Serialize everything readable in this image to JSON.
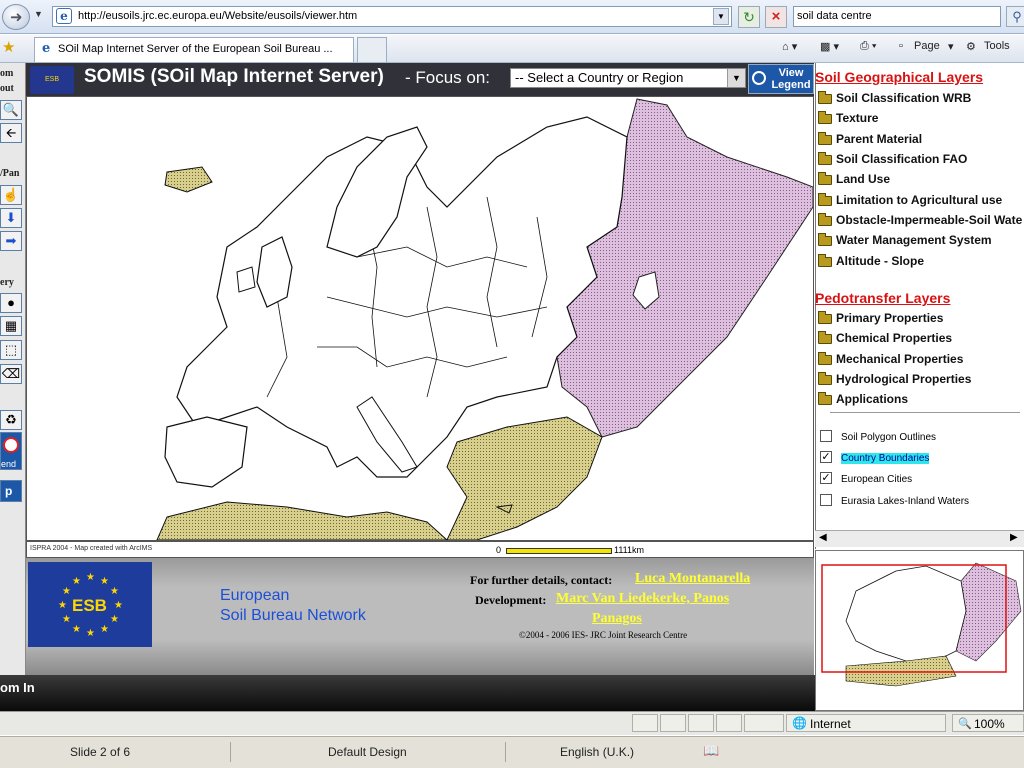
{
  "browser": {
    "url": "http://eusoils.jrc.ec.europa.eu/Website/eusoils/viewer.htm",
    "search_value": "soil data centre",
    "tab_title": "SOil Map Internet Server of the European Soil Bureau ...",
    "toolbar": {
      "page_label": "Page",
      "tools_label": "Tools"
    }
  },
  "left_toolbar": {
    "labels": [
      "om",
      "out",
      "/Pan",
      "ery",
      "end",
      "p"
    ]
  },
  "header": {
    "badge": "ESB",
    "title": "SOMIS (SOil Map Internet Server)",
    "focus_label": "- Focus on:",
    "region_select_value": "-- Select a Country or Region",
    "view_legend_label": "View Legend"
  },
  "map": {
    "credit": "ISPRA 2004 - Map created with ArcIMS",
    "scale_start": "0",
    "scale_end": "1111km",
    "colors": {
      "land": "#ffffff",
      "outline": "#000000",
      "east_region": "#dcc0de",
      "south_region": "#d8cf8c"
    }
  },
  "footer": {
    "logo_text": "ESB",
    "network_line1": "European",
    "network_line2": "Soil Bureau Network",
    "contact_label": "For further details, contact:",
    "contact_name": "Luca Montanarella",
    "dev_label": "Development:",
    "dev_names_line1": "Marc Van Liedekerke, Panos",
    "dev_names_line2": "Panagos",
    "copyright": "©2004 - 2006 IES- JRC Joint Research Centre"
  },
  "status_text": "om In",
  "right_panel": {
    "geo_title": "Soil Geographical Layers",
    "geo_layers": [
      "Soil Classification WRB",
      "Texture",
      "Parent Material",
      "Soil Classification FAO",
      "Land Use",
      "Limitation to Agricultural use",
      "Obstacle-Impermeable-Soil Wate",
      "Water Management System",
      "Altitude - Slope"
    ],
    "pedo_title": "Pedotransfer Layers",
    "pedo_layers": [
      "Primary Properties",
      "Chemical Properties",
      "Mechanical Properties",
      "Hydrological Properties",
      "Applications"
    ],
    "checks": [
      {
        "label": "Soil Polygon Outlines",
        "checked": false
      },
      {
        "label": "Country Boundaries",
        "checked": true
      },
      {
        "label": "European Cities",
        "checked": true
      },
      {
        "label": "Eurasia Lakes-Inland Waters",
        "checked": false
      }
    ]
  },
  "ie_status": {
    "zone": "Internet",
    "zoom": "100%"
  },
  "ppt_status": {
    "slide": "Slide 2 of 6",
    "design": "Default Design",
    "language": "English (U.K.)"
  }
}
